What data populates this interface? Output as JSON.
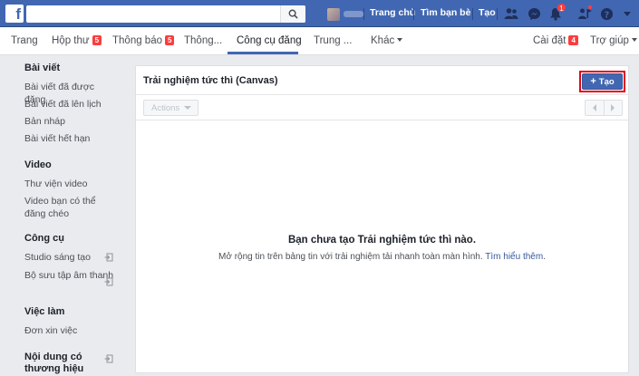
{
  "topbar": {
    "logo": "f",
    "search": {
      "value": "",
      "placeholder": ""
    },
    "nav": [
      "Trang chủ",
      "Tìm bạn bè",
      "Tạo"
    ],
    "icons": [
      "friends-icon",
      "messenger-icon",
      "bell-icon",
      "pages-icon",
      "help-icon"
    ],
    "badges": {
      "notifications": "1"
    }
  },
  "subnav": {
    "tabs": [
      {
        "label": "Trang"
      },
      {
        "label": "Hộp thư",
        "badge": "5"
      },
      {
        "label": "Thông báo",
        "badge": "5"
      },
      {
        "label": "Thông..."
      },
      {
        "label": "Công cụ đăng"
      },
      {
        "label": "Trung ..."
      },
      {
        "label": "Khác"
      }
    ],
    "settings": {
      "label": "Cài đặt",
      "badge": "4"
    },
    "help": "Trợ giúp"
  },
  "sidebar": {
    "sections": [
      {
        "title": "Bài viết",
        "items": [
          "Bài viết đã được đăng",
          "Bài viết đã lên lịch",
          "Bản nháp",
          "Bài viết hết hạn"
        ]
      },
      {
        "title": "Video",
        "items": [
          "Thư viện video",
          "Video bạn có thể đăng chéo"
        ]
      },
      {
        "title": "Công cụ",
        "items": [
          "Studio sáng tạo",
          "Bộ sưu tập âm thanh"
        ]
      },
      {
        "title": "Việc làm",
        "items": [
          "Đơn xin việc"
        ]
      },
      {
        "title": "Nội dung có thương hiệu",
        "items": []
      }
    ]
  },
  "panel": {
    "title": "Trải nghiệm tức thì (Canvas)",
    "create_label": "Tạo",
    "actions_label": "Actions",
    "empty_title": "Bạn chưa tạo Trải nghiệm tức thì nào.",
    "empty_desc": "Mở rộng tin trên bảng tin với trải nghiệm tải nhanh toàn màn hình.",
    "learn_more": "Tìm hiểu thêm",
    "learn_more_end": "."
  },
  "colors": {
    "brand_blue": "#4267b2",
    "highlight_red": "#e0071a",
    "badge_red": "#fa3e3e"
  }
}
